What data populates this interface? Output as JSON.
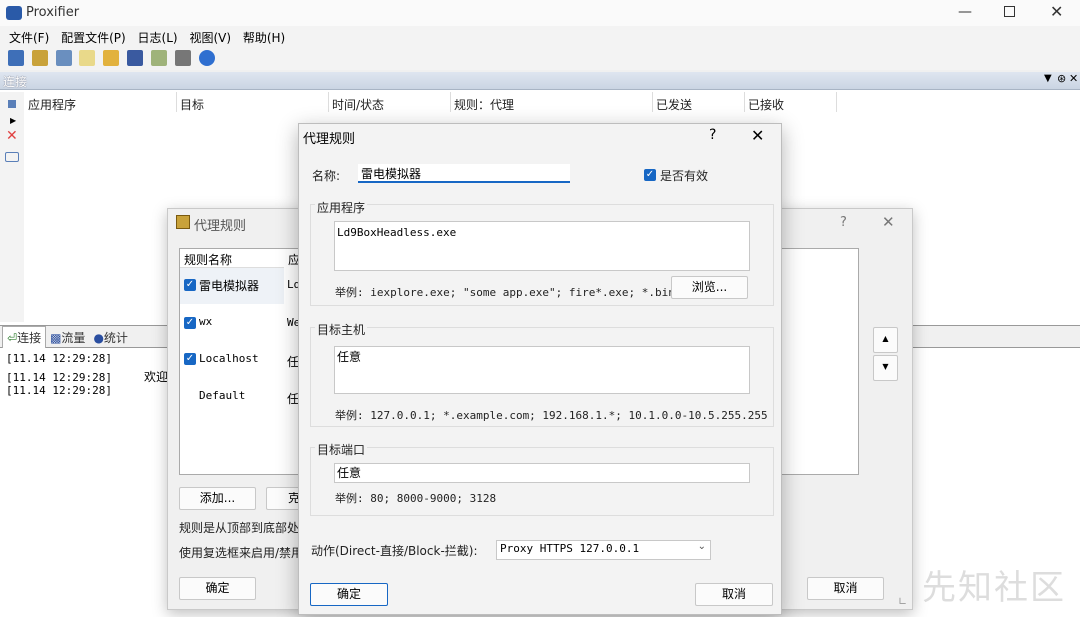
{
  "app": {
    "title": "Proxifier"
  },
  "menu": [
    "文件(F)",
    "配置文件(P)",
    "日志(L)",
    "视图(V)",
    "帮助(H)"
  ],
  "connections": {
    "header": "连接",
    "columns": [
      "应用程序",
      "目标",
      "时间/状态",
      "规则：代理",
      "已发送",
      "已接收"
    ]
  },
  "tabs": [
    "连接",
    "流量",
    "统计"
  ],
  "log": {
    "lines": [
      {
        "time": "[11.14 12:29:28]",
        "text": ""
      },
      {
        "time": "[11.14 12:29:28]",
        "text": "欢迎使"
      },
      {
        "time": "[11.14 12:29:28]",
        "text": ""
      }
    ]
  },
  "rules_dialog": {
    "title": "代理规则",
    "help": "?",
    "columns": [
      "规则名称",
      "应"
    ],
    "rows": [
      {
        "name": "雷电模拟器",
        "app": "Ld",
        "checked": true
      },
      {
        "name": "wx",
        "app": "We",
        "checked": true
      },
      {
        "name": "Localhost",
        "app": "任",
        "checked": true
      },
      {
        "name": "Default",
        "app": "任",
        "checked": false
      }
    ],
    "add_label": "添加...",
    "clone_label": "克",
    "note1": "规则是从顶部到底部处",
    "note2": "使用复选框来启用/禁用",
    "ok_label": "确定",
    "cancel_label": "取消"
  },
  "edit_dialog": {
    "title": "代理规则",
    "help": "?",
    "name_label": "名称:",
    "name_value": "雷电模拟器",
    "enabled_label": "是否有效",
    "app_group": "应用程序",
    "app_value": "Ld9BoxHeadless.exe",
    "app_hint": "举例: iexplore.exe; \"some app.exe\"; fire*.exe; *.bin",
    "browse_label": "浏览...",
    "host_group": "目标主机",
    "host_value": "任意",
    "host_hint": "举例: 127.0.0.1; *.example.com; 192.168.1.*; 10.1.0.0-10.5.255.255",
    "port_group": "目标端口",
    "port_value": "任意",
    "port_hint": "举例: 80; 8000-9000; 3128",
    "action_label": "动作(Direct-直接/Block-拦截):",
    "action_value": "Proxy HTTPS 127.0.0.1",
    "ok_label": "确定",
    "cancel_label": "取消"
  },
  "watermark": "先知社区"
}
